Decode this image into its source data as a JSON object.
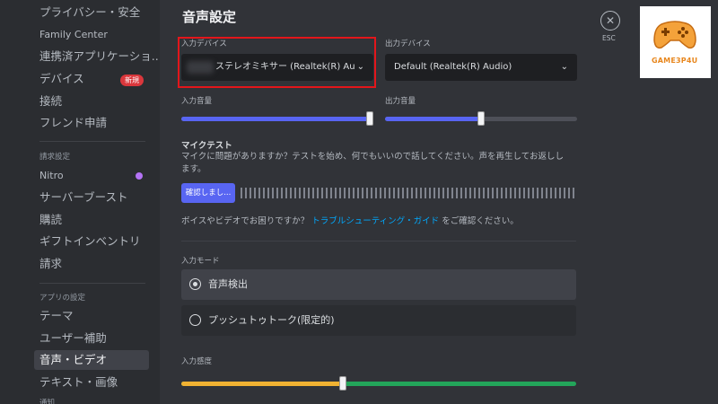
{
  "sidebar": {
    "items": [
      {
        "label": "プライバシー・安全"
      },
      {
        "label": "Family Center"
      },
      {
        "label": "連携済アプリケーショ..."
      },
      {
        "label": "デバイス"
      },
      {
        "label": "接続"
      },
      {
        "label": "フレンド申請"
      },
      {
        "label": "Nitro"
      },
      {
        "label": "サーバーブースト"
      },
      {
        "label": "購読"
      },
      {
        "label": "ギフトインベントリ"
      },
      {
        "label": "請求"
      },
      {
        "label": "テーマ"
      },
      {
        "label": "ユーザー補助"
      },
      {
        "label": "音声・ビデオ"
      },
      {
        "label": "テキスト・画像"
      }
    ],
    "headers": {
      "billing": "請求設定",
      "app": "アプリの設定",
      "notifications": "通知"
    },
    "new_badge": "新規"
  },
  "main": {
    "title": "音声設定",
    "input_device": {
      "label": "入力デバイス",
      "value": "ステレオミキサー (Realtek(R) Au"
    },
    "output_device": {
      "label": "出力デバイス",
      "value": "Default (Realtek(R) Audio)"
    },
    "input_volume": {
      "label": "入力音量",
      "level": 1.0
    },
    "output_volume": {
      "label": "出力音量",
      "level": 0.5
    },
    "mic_test": {
      "title": "マイクテスト",
      "description": "マイクに問題がありますか？テストを始め、何でもいいので話してください。声を再生してお返しします。",
      "button": "確認しまし..."
    },
    "help": {
      "prefix": "ボイスやビデオでお困りですか？",
      "link": "トラブルシューティング・ガイド",
      "suffix": "をご確認ください。"
    },
    "input_mode": {
      "label": "入力モード",
      "options": [
        {
          "label": "音声検出",
          "selected": true
        },
        {
          "label": "プッシュトゥトーク(限定的)",
          "selected": false
        }
      ]
    },
    "sensitivity": {
      "label": "入力感度",
      "level": 0.41
    }
  },
  "esc": {
    "label": "ESC"
  },
  "watermark": {
    "text": "GAME3P4U"
  },
  "colors": {
    "accent": "#5865f2",
    "link": "#00a8fc",
    "highlight": "#e3161b",
    "sensitivity_active": "#23a55a",
    "sensitivity_inactive": "#f0b232"
  }
}
